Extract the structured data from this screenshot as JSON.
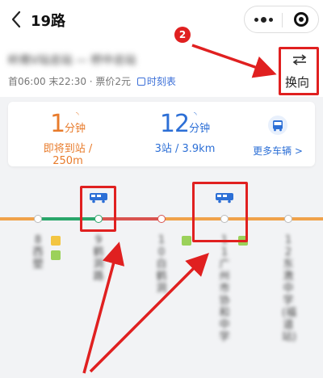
{
  "nav": {
    "title": "19路"
  },
  "header": {
    "route_name": "岭南V站总站 — 桥中总站",
    "schedule": "首06:00 末22:30 · 票价2元",
    "timetable_label": "时刻表",
    "direction_label": "换向"
  },
  "arrivals": {
    "first": {
      "num": "1",
      "unit": "分钟",
      "detail": "即将到站 / 250m"
    },
    "second": {
      "num": "12",
      "unit": "分钟",
      "detail": "3站 / 3.9km"
    },
    "more_buses_label": "更多车辆 >"
  },
  "stops": [
    {
      "label": "8西塱"
    },
    {
      "label": "9鹤洞路"
    },
    {
      "label": "10白鹤洞"
    },
    {
      "label": "11广州市协和中学"
    },
    {
      "label": "12东漖中学(福道站)"
    }
  ],
  "annotation": {
    "step": "2"
  },
  "colors": {
    "accent_orange": "#e87b2b",
    "accent_blue": "#2c6fd6",
    "line_green": "#2aa66a",
    "line_red": "#d9534f",
    "line_orange": "#f0a24a",
    "highlight_red": "#e02020"
  }
}
